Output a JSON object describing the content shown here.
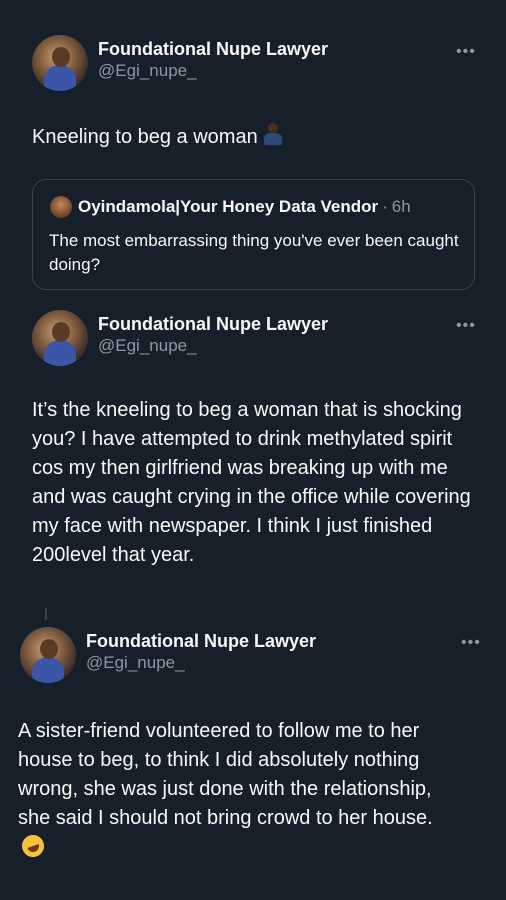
{
  "tweets": [
    {
      "display_name": "Foundational Nupe Lawyer",
      "handle": "@Egi_nupe_",
      "text": "Kneeling to beg a woman",
      "emoji": "person-kneeling-icon"
    },
    {
      "display_name": "Foundational Nupe Lawyer",
      "handle": "@Egi_nupe_",
      "text": "It’s the kneeling to beg a woman that is shocking you? I have attempted to drink methylated spirit cos my then girlfriend was breaking up with me and was caught crying in the office while covering my face with newspaper. I think I just finished 200level that year."
    },
    {
      "display_name": "Foundational Nupe Lawyer",
      "handle": "@Egi_nupe_",
      "text": "A sister-friend volunteered to follow me to her house to beg, to think I did absolutely nothing wrong, she was just done with the relationship, she said I should not bring crowd to her house.",
      "emoji": "rolling-on-floor-laughing-icon"
    }
  ],
  "quote": {
    "display_name": "Oyindamola|Your Honey Data Vendor",
    "separator": "·",
    "time": "6h",
    "text": "The most embarrassing thing you've ever been caught doing?"
  },
  "more_glyph": "•••",
  "colors": {
    "background": "#15202b",
    "text": "#f7f9f9",
    "secondary": "#8b98a5",
    "border": "#38444d"
  }
}
